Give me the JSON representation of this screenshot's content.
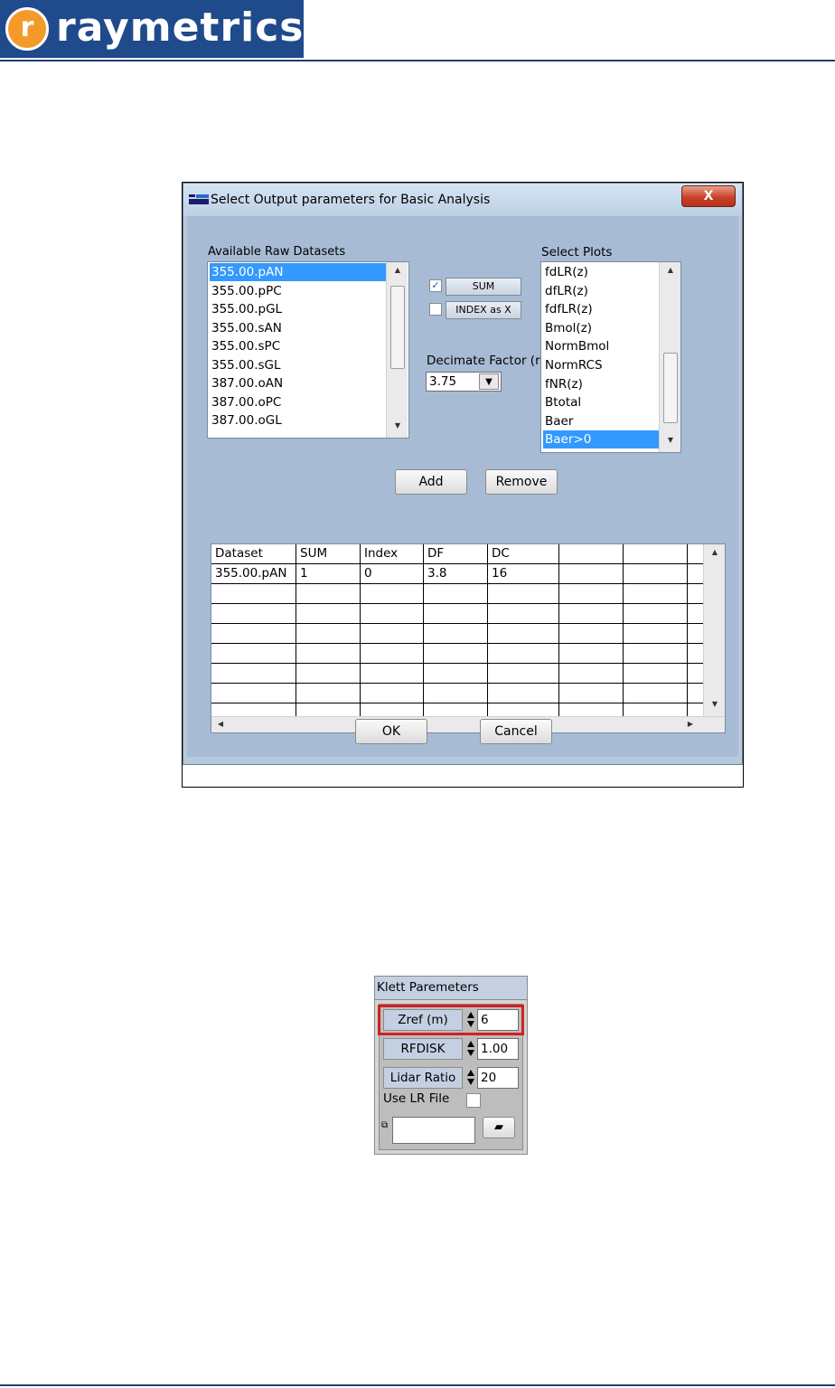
{
  "brand": {
    "logo_letter": "r",
    "name": "raymetrics"
  },
  "dialog": {
    "title": "Select Output parameters for Basic Analysis",
    "close_label": "X",
    "datasets_label": "Available Raw Datasets",
    "datasets": [
      "355.00.pAN",
      "355.00.pPC",
      "355.00.pGL",
      "355.00.sAN",
      "355.00.sPC",
      "355.00.sGL",
      "387.00.oAN",
      "387.00.oPC",
      "387.00.oGL"
    ],
    "sum_label": "SUM",
    "sum_checked": true,
    "index_label": "INDEX as X",
    "index_checked": false,
    "decimate_label": "Decimate Factor (r",
    "decimate_value": "3.75",
    "plots_label": "Select Plots",
    "plots": [
      "fdLR(z)",
      "dfLR(z)",
      "fdfLR(z)",
      "Bmol(z)",
      "NormBmol",
      "NormRCS",
      "fNR(z)",
      "Btotal",
      "Baer",
      "Baer>0"
    ],
    "add_label": "Add",
    "remove_label": "Remove",
    "table": {
      "headers": [
        "Dataset",
        "SUM",
        "Index",
        "DF",
        "DC",
        "",
        "",
        ""
      ],
      "rows": [
        [
          "355.00.pAN",
          "1",
          "0",
          "3.8",
          "16",
          "",
          "",
          ""
        ]
      ]
    },
    "ok_label": "OK",
    "cancel_label": "Cancel"
  },
  "klett": {
    "title": "Klett Paremeters",
    "fields": [
      {
        "label": "Zref (m)",
        "value": "6"
      },
      {
        "label": "RFDISK",
        "value": "1.00"
      },
      {
        "label": "Lidar Ratio",
        "value": "20"
      }
    ],
    "use_lr_label": "Use LR File",
    "use_lr_checked": false,
    "path_value": "",
    "highlight_color": "#d42020"
  }
}
